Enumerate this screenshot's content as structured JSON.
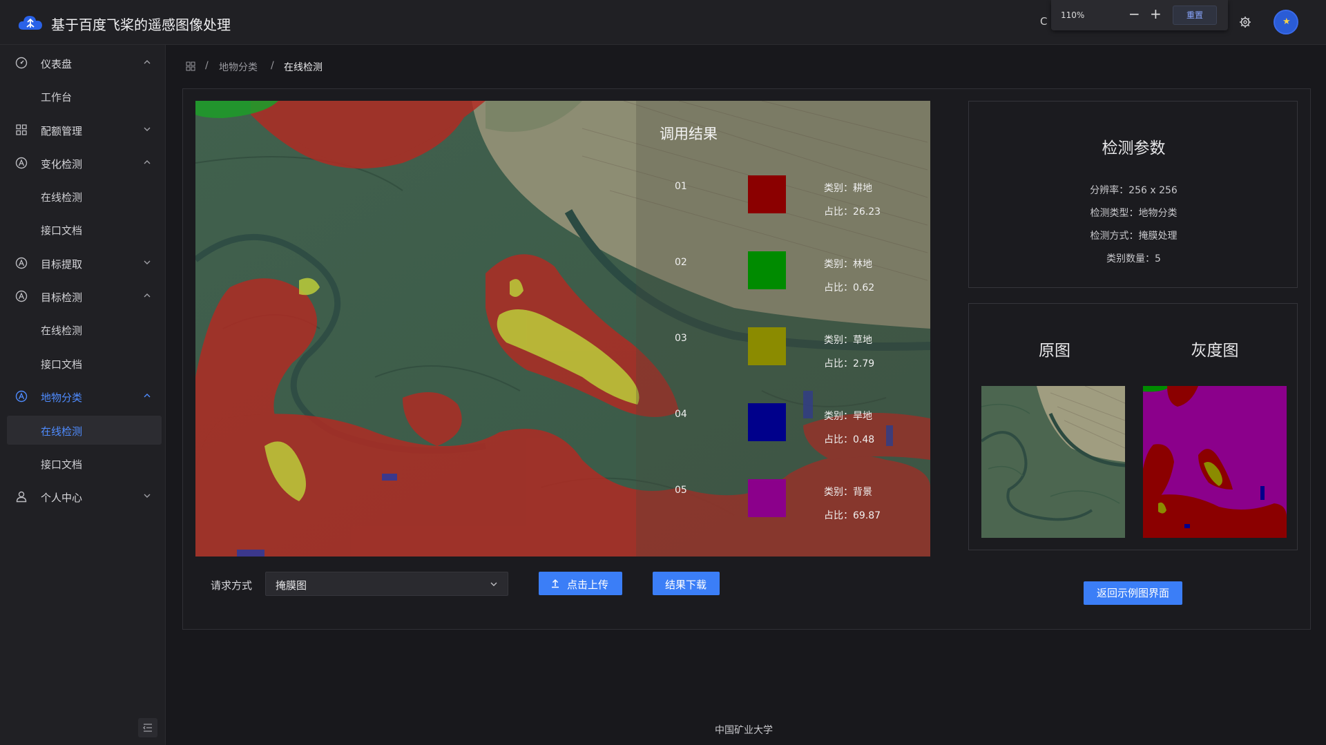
{
  "header": {
    "app_title": "基于百度飞桨的遥感图像处理",
    "zoom_level": "110%",
    "zoom_out": "−",
    "zoom_in": "+",
    "zoom_reset": "重置",
    "refresh_glyph": "C"
  },
  "sidebar": {
    "items": [
      {
        "label": "仪表盘"
      },
      {
        "label": "工作台"
      },
      {
        "label": "配额管理"
      },
      {
        "label": "变化检测"
      },
      {
        "label": "在线检测"
      },
      {
        "label": "接口文档"
      },
      {
        "label": "目标提取"
      },
      {
        "label": "目标检测"
      },
      {
        "label": "在线检测"
      },
      {
        "label": "接口文档"
      },
      {
        "label": "地物分类"
      },
      {
        "label": "在线检测"
      },
      {
        "label": "接口文档"
      },
      {
        "label": "个人中心"
      }
    ]
  },
  "breadcrumb": {
    "sep": "/",
    "level1": "地物分类",
    "level2": "在线检测"
  },
  "result": {
    "title": "调用结果",
    "classes": [
      {
        "num": "01",
        "name": "类别：耕地",
        "ratio": "占比：26.23",
        "color": "#8b0000"
      },
      {
        "num": "02",
        "name": "类别：林地",
        "ratio": "占比：0.62",
        "color": "#008b00"
      },
      {
        "num": "03",
        "name": "类别：草地",
        "ratio": "占比：2.79",
        "color": "#8b8b00"
      },
      {
        "num": "04",
        "name": "类别：旱地",
        "ratio": "占比：0.48",
        "color": "#00008b"
      },
      {
        "num": "05",
        "name": "类别：背景",
        "ratio": "占比：69.87",
        "color": "#8b008b"
      }
    ]
  },
  "controls": {
    "request_label": "请求方式",
    "request_value": "掩膜图",
    "upload_label": "点击上传",
    "download_label": "结果下载"
  },
  "params": {
    "title": "检测参数",
    "resolution": "分辨率：256 x 256",
    "type": "检测类型：地物分类",
    "method": "检测方式：掩膜处理",
    "count": "类别数量：5"
  },
  "compare": {
    "original_title": "原图",
    "gray_title": "灰度图",
    "back_label": "返回示例图界面"
  },
  "footer": {
    "text": "中国矿业大学"
  },
  "colors": {
    "accent": "#3b7ef7",
    "active_text": "#4f8cff",
    "background": "#18181c"
  }
}
